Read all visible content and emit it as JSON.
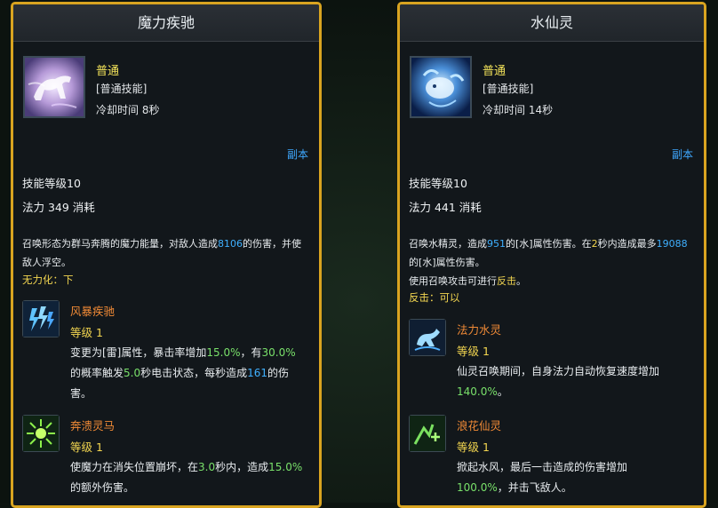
{
  "left": {
    "title": "魔力疾驰",
    "rank": "普通",
    "type": "[普通技能]",
    "cooldown": "冷却时间 8秒",
    "tag": "副本",
    "level": "技能等级10",
    "mana": "法力 349 消耗",
    "desc": {
      "p1": "召唤形态为群马奔腾的魔力能量，对敌人造成",
      "n1": "8106",
      "p2": "的伤害，并使敌人浮空。"
    },
    "note": "无力化：下",
    "talents": [
      {
        "name": "风暴疾驰",
        "level": "等级 1",
        "p1": "变更为[雷]属性，暴击率增加",
        "g1": "15.0%",
        "p2": "，有",
        "g2": "30.0%",
        "p3": "的概率触发",
        "g3": "5.0",
        "p4": "秒电击状态，每秒造成",
        "b1": "161",
        "p5": "的伤害。",
        "icon": "lightning-icon"
      },
      {
        "name": "奔溃灵马",
        "level": "等级 1",
        "p1": "使魔力在消失位置崩坏，在",
        "g1": "3.0",
        "p2": "秒内，造成",
        "g2": "15.0%",
        "p3": "的额外伤害。",
        "icon": "burst-icon"
      }
    ]
  },
  "right": {
    "title": "水仙灵",
    "rank": "普通",
    "type": "[普通技能]",
    "cooldown": "冷却时间 14秒",
    "tag": "副本",
    "level": "技能等级10",
    "mana": "法力 441 消耗",
    "desc": {
      "p1": "召唤水精灵，造成",
      "n1": "951",
      "p2": "的[水]属性伤害。在",
      "y1": "2",
      "p3": "秒内造成最多",
      "n2": "19088",
      "p4": "的[水]属性伤害。",
      "p5": "使用召唤攻击可进行",
      "y2": "反击",
      "p6": "。"
    },
    "note": "反击：可以",
    "talents": [
      {
        "name": "法力水灵",
        "level": "等级 1",
        "p1": "仙灵召唤期间，自身法力自动恢复速度增加",
        "g1": "140.0%",
        "p2": "。",
        "icon": "water-spirit-icon"
      },
      {
        "name": "浪花仙灵",
        "level": "等级 1",
        "p1": "掀起水风，最后一击造成的伤害增加",
        "g1": "100.0%",
        "p2": "，并击飞敌人。",
        "icon": "splash-icon"
      }
    ]
  },
  "colors": {
    "frame": "#d9a420",
    "rank": "#f3e35a",
    "value_blue": "#3fb0ff",
    "value_green": "#79e06a",
    "talent_name": "#f08a36"
  }
}
